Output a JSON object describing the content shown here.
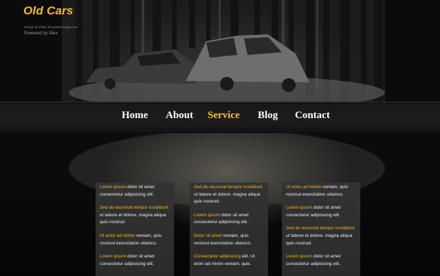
{
  "site": {
    "title": "Old Cars",
    "credit": "Design by Flash Templates Today.com",
    "powered": "Powered by Slex"
  },
  "nav": {
    "items": [
      {
        "label": "Home",
        "active": false
      },
      {
        "label": "About",
        "active": false
      },
      {
        "label": "Service",
        "active": true
      },
      {
        "label": "Blog",
        "active": false
      },
      {
        "label": "Contact",
        "active": false
      }
    ]
  },
  "colors": {
    "accent": "#f5c21a",
    "text": "#ffffff",
    "panel": "#2e2e2e"
  },
  "columns": [
    {
      "paragraphs": [
        {
          "hl": "Lorem ipsum",
          "rest": " dolor sit amet consectetur adipisicing elit."
        },
        {
          "hl": "Sed do eiusmod tempor incididunt",
          "rest": " ut labore et dolore. magna aliqua quis nostrud."
        },
        {
          "hl": "Ut enim ad minim",
          "rest": " veniam, quis nostrud exercitation ullamco ."
        },
        {
          "hl": "Lorem ipsum",
          "rest": " dolor sit amet consectetur adipisicing elit."
        }
      ]
    },
    {
      "paragraphs": [
        {
          "hl": "Sed do eiusmod tempor incididunt",
          "rest": " ut labore et dolore. magna aliqua quis nostrud."
        },
        {
          "hl": "Lorem ipsum",
          "rest": " dolor sit amet consectetur adipisicing elit."
        },
        {
          "hl": " Dolor sit amet",
          "rest": " veniam, quis nostrud exercitation ullamco ."
        },
        {
          "hl": "Consectetur adipisicing",
          "rest": " elit. Ut enim ad minim veniam, quis."
        }
      ]
    },
    {
      "paragraphs": [
        {
          "hl": "Ut enim ad minim",
          "rest": " veniam, quis nostrud exercitation ullamco ."
        },
        {
          "hl": "Lorem ipsum",
          "rest": " dolor sit amet consectetur adipisicing elit."
        },
        {
          "hl": "Sed do eiusmod tempor incididunt",
          "rest": " ut labore et dolore. magna aliqua quis nostrud."
        },
        {
          "hl": "Lorem ipsum",
          "rest": " dolor sit amet consectetur adipisicing elit."
        }
      ]
    }
  ]
}
